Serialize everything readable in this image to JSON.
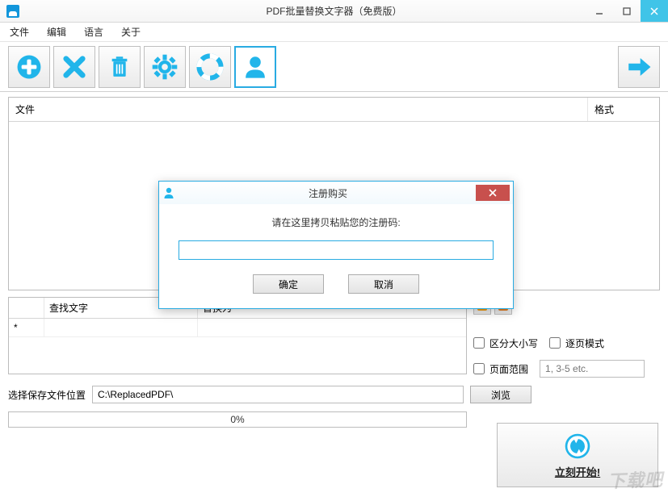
{
  "window": {
    "title": "PDF批量替换文字器（免费版）",
    "minimize": "_",
    "maximize": "□",
    "close": "×"
  },
  "menu": {
    "file": "文件",
    "edit": "编辑",
    "language": "语言",
    "about": "关于"
  },
  "toolbar_icons": {
    "add": "add-icon",
    "delete": "delete-icon",
    "trash": "trash-icon",
    "settings": "settings-icon",
    "help": "help-icon",
    "user": "user-icon",
    "next": "next-icon"
  },
  "filelist": {
    "col_file": "文件",
    "col_format": "格式"
  },
  "replace_table": {
    "col_blank": "",
    "col_find": "查找文字",
    "col_replace": "替换为",
    "rows": [
      {
        "marker": "*",
        "find": "",
        "replace": ""
      }
    ]
  },
  "options": {
    "case_sensitive": "区分大小写",
    "page_mode": "逐页模式",
    "page_range": "页面范围",
    "range_placeholder": "1, 3-5 etc."
  },
  "save": {
    "label": "选择保存文件位置",
    "path": "C:\\ReplacedPDF\\",
    "browse": "浏览"
  },
  "progress": {
    "text": "0%"
  },
  "start": {
    "label": "立刻开始!"
  },
  "modal": {
    "title": "注册购买",
    "message": "请在这里拷贝粘贴您的注册码:",
    "input_value": "",
    "ok": "确定",
    "cancel": "取消"
  },
  "watermark": "下载吧"
}
